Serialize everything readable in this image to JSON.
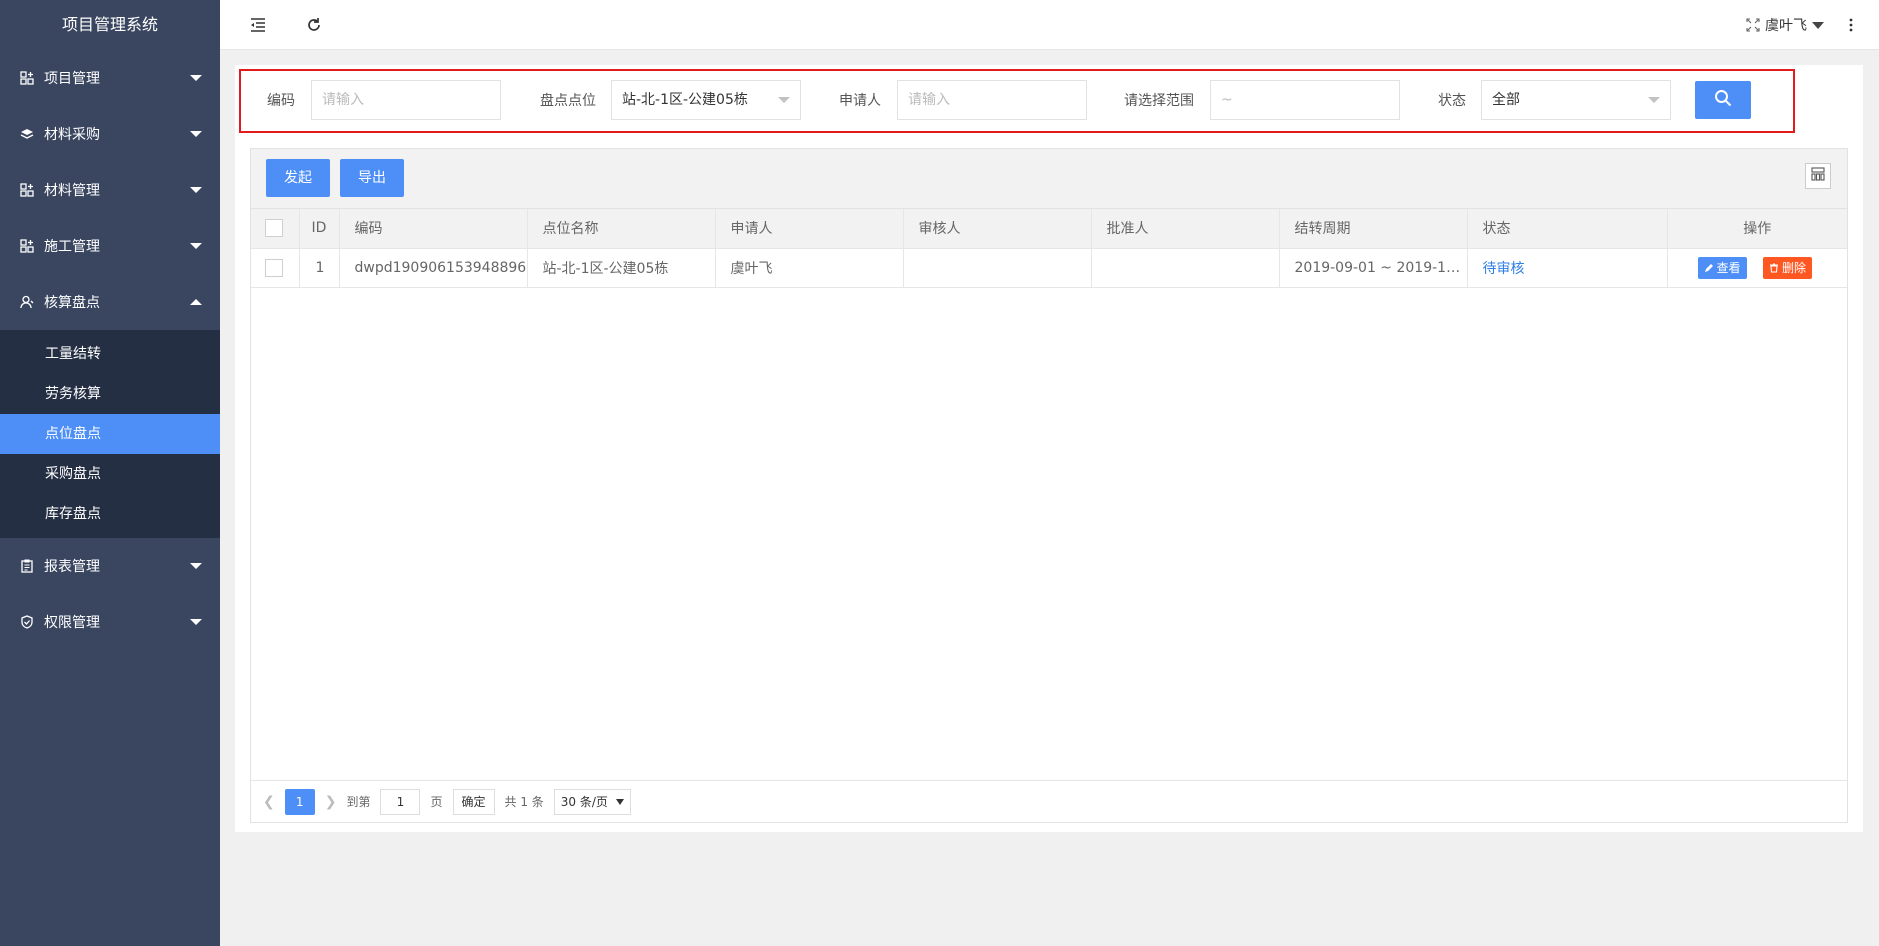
{
  "app": {
    "title": "项目管理系统"
  },
  "sidebar": {
    "items": [
      {
        "label": "项目管理",
        "icon": "modules-icon",
        "expanded": false
      },
      {
        "label": "材料采购",
        "icon": "layers-icon",
        "expanded": false
      },
      {
        "label": "材料管理",
        "icon": "modules-icon",
        "expanded": false
      },
      {
        "label": "施工管理",
        "icon": "modules-icon",
        "expanded": false
      },
      {
        "label": "核算盘点",
        "icon": "user-icon",
        "expanded": true,
        "children": [
          {
            "label": "工量结转",
            "active": false
          },
          {
            "label": "劳务核算",
            "active": false
          },
          {
            "label": "点位盘点",
            "active": true
          },
          {
            "label": "采购盘点",
            "active": false
          },
          {
            "label": "库存盘点",
            "active": false
          }
        ]
      },
      {
        "label": "报表管理",
        "icon": "clipboard-icon",
        "expanded": false
      },
      {
        "label": "权限管理",
        "icon": "shield-icon",
        "expanded": false
      }
    ]
  },
  "header": {
    "user": "虞叶飞"
  },
  "search": {
    "code_label": "编码",
    "code_placeholder": "请输入",
    "location_label": "盘点点位",
    "location_value": "站-北-1区-公建05栋",
    "applicant_label": "申请人",
    "applicant_placeholder": "请输入",
    "range_label": "请选择范围",
    "range_placeholder": "~",
    "status_label": "状态",
    "status_value": "全部"
  },
  "toolbar": {
    "start_label": "发起",
    "export_label": "导出"
  },
  "table": {
    "columns": [
      "ID",
      "编码",
      "点位名称",
      "申请人",
      "审核人",
      "批准人",
      "结转周期",
      "状态",
      "操作"
    ],
    "rows": [
      {
        "id": "1",
        "code": "dwpd190906153948896",
        "location": "站-北-1区-公建05栋",
        "applicant": "虞叶飞",
        "reviewer": "",
        "approver": "",
        "period": "2019-09-01 ~ 2019-10...",
        "status": "待审核"
      }
    ],
    "view_label": "查看",
    "delete_label": "删除"
  },
  "pager": {
    "current": "1",
    "goto_label": "到第",
    "goto_value": "1",
    "page_suffix": "页",
    "confirm_label": "确定",
    "total": "共 1 条",
    "page_size": "30 条/页"
  },
  "colors": {
    "sidebar": "#3a4660",
    "submenu": "#252f44",
    "accent": "#4e8ff7",
    "danger": "#ff5722",
    "highlight_border": "#e21c1c"
  }
}
